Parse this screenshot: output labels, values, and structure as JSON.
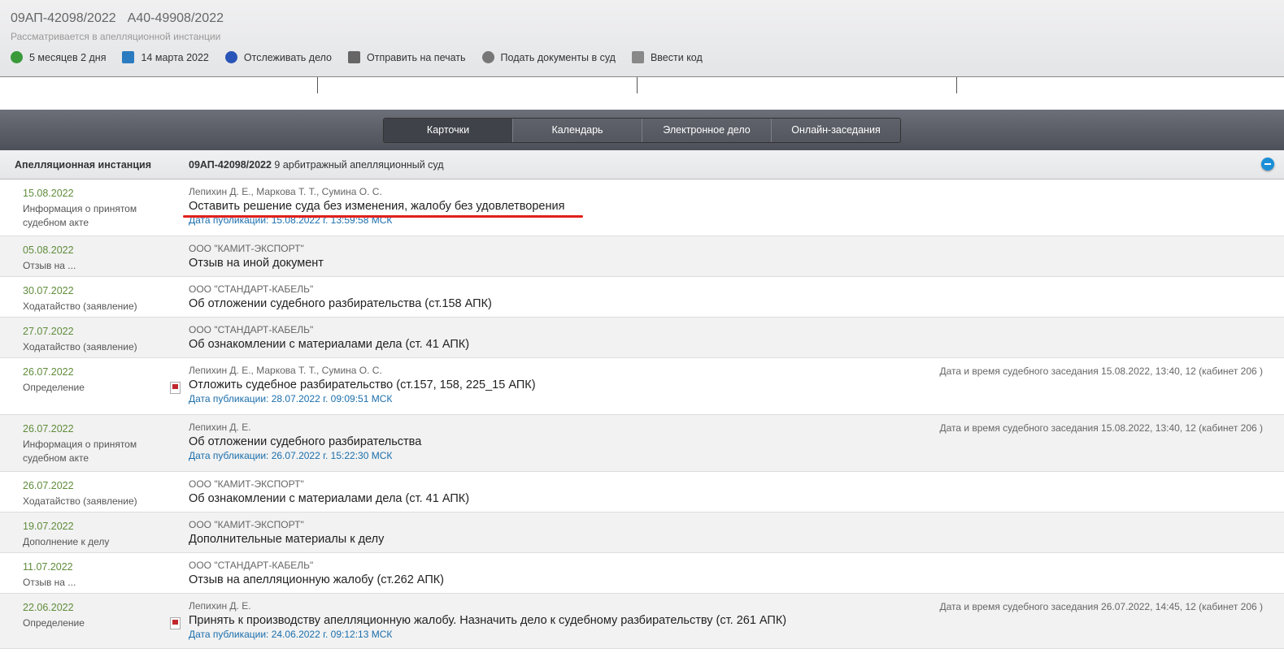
{
  "header": {
    "case_number": "09АП-42098/2022",
    "first_instance_number": "А40-49908/2022",
    "status": "Рассматривается в апелляционной инстанции",
    "tools": [
      {
        "icon": "clock-icon",
        "label": "5 месяцев 2 дня"
      },
      {
        "icon": "calendar-icon",
        "label": "14 марта 2022"
      },
      {
        "icon": "shield-icon",
        "label": "Отслеживать дело"
      },
      {
        "icon": "printer-icon",
        "label": "Отправить на печать"
      },
      {
        "icon": "plus-circle-icon",
        "label": "Подать документы в суд"
      },
      {
        "icon": "code-icon",
        "label": "Ввести код"
      }
    ]
  },
  "tabs": [
    "Карточки",
    "Календарь",
    "Электронное дело",
    "Онлайн-заседания"
  ],
  "instance": {
    "label": "Апелляционная инстанция",
    "case": "09АП-42098/2022",
    "court": " 9 арбитражный апелляционный суд"
  },
  "rows": [
    {
      "date": "15.08.2022",
      "type": "Информация о принятом судебном акте",
      "who": "Лепихин Д. Е., Маркова Т. Т., Сумина О. С.",
      "title": "Оставить решение суда без изменения, жалобу без удовлетворения",
      "pub": "Дата публикации: 15.08.2022 г. 13:59:58 МСК"
    },
    {
      "date": "05.08.2022",
      "type": "Отзыв на ...",
      "who": "ООО \"КАМИТ-ЭКСПОРТ\"",
      "title": "Отзыв на иной документ"
    },
    {
      "date": "30.07.2022",
      "type": "Ходатайство (заявление)",
      "who": "ООО \"СТАНДАРТ-КАБЕЛЬ\"",
      "title": "Об отложении судебного разбирательства (ст.158 АПК)"
    },
    {
      "date": "27.07.2022",
      "type": "Ходатайство (заявление)",
      "who": "ООО \"СТАНДАРТ-КАБЕЛЬ\"",
      "title": "Об ознакомлении с материалами дела (ст. 41 АПК)"
    },
    {
      "date": "26.07.2022",
      "type": "Определение",
      "who": "Лепихин Д. Е., Маркова Т. Т., Сумина О. С.",
      "title": "Отложить судебное разбирательство (ст.157, 158, 225_15 АПК)",
      "pub": "Дата публикации: 28.07.2022 г. 09:09:51 МСК",
      "hearing": "Дата и время судебного заседания 15.08.2022, 13:40, 12 (кабинет 206 )",
      "pdf": true
    },
    {
      "date": "26.07.2022",
      "type": "Информация о принятом судебном акте",
      "who": "Лепихин Д. Е.",
      "title": "Об отложении судебного разбирательства",
      "pub": "Дата публикации: 26.07.2022 г. 15:22:30 МСК",
      "hearing": "Дата и время судебного заседания 15.08.2022, 13:40, 12 (кабинет 206 )"
    },
    {
      "date": "26.07.2022",
      "type": "Ходатайство (заявление)",
      "who": "ООО \"КАМИТ-ЭКСПОРТ\"",
      "title": "Об ознакомлении с материалами дела (ст. 41 АПК)"
    },
    {
      "date": "19.07.2022",
      "type": "Дополнение к делу",
      "who": "ООО \"КАМИТ-ЭКСПОРТ\"",
      "title": "Дополнительные материалы к делу"
    },
    {
      "date": "11.07.2022",
      "type": "Отзыв на ...",
      "who": "ООО \"СТАНДАРТ-КАБЕЛЬ\"",
      "title": "Отзыв на апелляционную жалобу (ст.262 АПК)"
    },
    {
      "date": "22.06.2022",
      "type": "Определение",
      "who": "Лепихин Д. Е.",
      "title": "Принять к производству апелляционную жалобу. Назначить дело к судебному разбирательству (ст. 261 АПК)",
      "pub": "Дата публикации: 24.06.2022 г. 09:12:13 МСК",
      "hearing": "Дата и время судебного заседания 26.07.2022, 14:45, 12 (кабинет 206 )",
      "pdf": true
    }
  ]
}
